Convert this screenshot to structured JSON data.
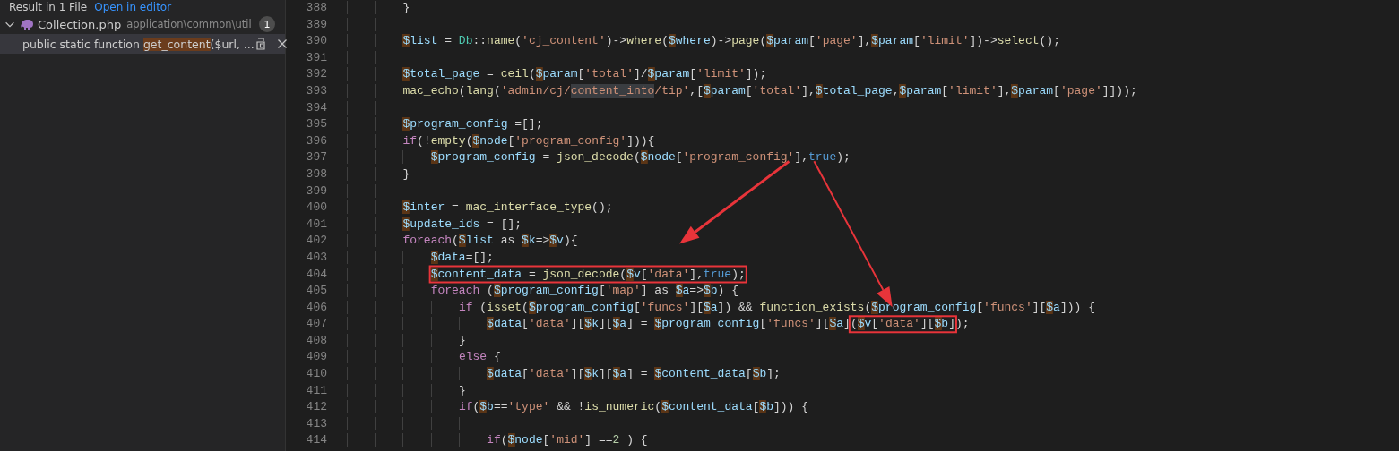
{
  "search_header": {
    "title": "Result in 1 File",
    "link": "Open in editor"
  },
  "results": [
    {
      "file": "Collection.php",
      "path": "application\\common\\util",
      "count": "1",
      "expanded": true,
      "matches": [
        {
          "before": "public static function ",
          "match": "get_content",
          "after": "($url, ...",
          "selected": true
        }
      ]
    }
  ],
  "editor": {
    "lines": [
      {
        "number": "388",
        "tokens": [
          {
            "kind": "plain",
            "text": "        }"
          }
        ]
      },
      {
        "number": "389"
      },
      {
        "number": "390",
        "tokens": [
          {
            "kind": "var",
            "text": "        $list"
          },
          {
            "kind": "plain",
            "text": " = "
          },
          {
            "kind": "cls",
            "text": "Db"
          },
          {
            "kind": "plain",
            "text": "::"
          },
          {
            "kind": "func",
            "text": "name"
          },
          {
            "kind": "plain",
            "text": "("
          },
          {
            "kind": "str",
            "text": "'cj_content'"
          },
          {
            "kind": "plain",
            "text": ")->"
          },
          {
            "kind": "func",
            "text": "where"
          },
          {
            "kind": "plain",
            "text": "("
          },
          {
            "kind": "var",
            "text": "$where"
          },
          {
            "kind": "plain",
            "text": ")->"
          },
          {
            "kind": "func",
            "text": "page"
          },
          {
            "kind": "plain",
            "text": "("
          },
          {
            "kind": "var",
            "text": "$param"
          },
          {
            "kind": "plain",
            "text": "["
          },
          {
            "kind": "str",
            "text": "'page'"
          },
          {
            "kind": "plain",
            "text": "],"
          },
          {
            "kind": "var",
            "text": "$param"
          },
          {
            "kind": "plain",
            "text": "["
          },
          {
            "kind": "str",
            "text": "'limit'"
          },
          {
            "kind": "plain",
            "text": "])->"
          },
          {
            "kind": "func",
            "text": "select"
          },
          {
            "kind": "plain",
            "text": "();"
          }
        ]
      },
      {
        "number": "391"
      },
      {
        "number": "392",
        "tokens": [
          {
            "kind": "var",
            "text": "        $total_page"
          },
          {
            "kind": "plain",
            "text": " = "
          },
          {
            "kind": "func",
            "text": "ceil"
          },
          {
            "kind": "plain",
            "text": "("
          },
          {
            "kind": "var",
            "text": "$param"
          },
          {
            "kind": "plain",
            "text": "["
          },
          {
            "kind": "str",
            "text": "'total'"
          },
          {
            "kind": "plain",
            "text": "]/"
          },
          {
            "kind": "var",
            "text": "$param"
          },
          {
            "kind": "plain",
            "text": "["
          },
          {
            "kind": "str",
            "text": "'limit'"
          },
          {
            "kind": "plain",
            "text": "]);"
          }
        ]
      },
      {
        "number": "393",
        "tokens": [
          {
            "kind": "func",
            "text": "        mac_echo"
          },
          {
            "kind": "plain",
            "text": "("
          },
          {
            "kind": "func",
            "text": "lang"
          },
          {
            "kind": "plain",
            "text": "("
          },
          {
            "kind": "str",
            "text": "'admin/cj/"
          },
          {
            "kind": "str",
            "text": "content_into",
            "highlight": true
          },
          {
            "kind": "str",
            "text": "/tip'"
          },
          {
            "kind": "plain",
            "text": ",["
          },
          {
            "kind": "var",
            "text": "$param"
          },
          {
            "kind": "plain",
            "text": "["
          },
          {
            "kind": "str",
            "text": "'total'"
          },
          {
            "kind": "plain",
            "text": "],"
          },
          {
            "kind": "var",
            "text": "$total_page"
          },
          {
            "kind": "plain",
            "text": ","
          },
          {
            "kind": "var",
            "text": "$param"
          },
          {
            "kind": "plain",
            "text": "["
          },
          {
            "kind": "str",
            "text": "'limit'"
          },
          {
            "kind": "plain",
            "text": "],"
          },
          {
            "kind": "var",
            "text": "$param"
          },
          {
            "kind": "plain",
            "text": "["
          },
          {
            "kind": "str",
            "text": "'page'"
          },
          {
            "kind": "plain",
            "text": "]]));"
          }
        ]
      },
      {
        "number": "394"
      },
      {
        "number": "395",
        "tokens": [
          {
            "kind": "var",
            "text": "        $program_config"
          },
          {
            "kind": "plain",
            "text": " =[];"
          }
        ]
      },
      {
        "number": "396",
        "tokens": [
          {
            "kind": "kw",
            "text": "        if"
          },
          {
            "kind": "plain",
            "text": "(!"
          },
          {
            "kind": "func",
            "text": "empty"
          },
          {
            "kind": "plain",
            "text": "("
          },
          {
            "kind": "var",
            "text": "$node"
          },
          {
            "kind": "plain",
            "text": "["
          },
          {
            "kind": "str",
            "text": "'program_config'"
          },
          {
            "kind": "plain",
            "text": "])){"
          }
        ]
      },
      {
        "number": "397",
        "tokens": [
          {
            "kind": "var",
            "text": "            $program_config"
          },
          {
            "kind": "plain",
            "text": " = "
          },
          {
            "kind": "func",
            "text": "json_decode"
          },
          {
            "kind": "plain",
            "text": "("
          },
          {
            "kind": "var",
            "text": "$node"
          },
          {
            "kind": "plain",
            "text": "["
          },
          {
            "kind": "str",
            "text": "'program_config'",
            "arrow_origin": true
          },
          {
            "kind": "plain",
            "text": "],"
          },
          {
            "kind": "const",
            "text": "true"
          },
          {
            "kind": "plain",
            "text": ");"
          }
        ]
      },
      {
        "number": "398",
        "tokens": [
          {
            "kind": "plain",
            "text": "        }"
          }
        ]
      },
      {
        "number": "399"
      },
      {
        "number": "400",
        "tokens": [
          {
            "kind": "var",
            "text": "        $inter"
          },
          {
            "kind": "plain",
            "text": " = "
          },
          {
            "kind": "func",
            "text": "mac_interface_type"
          },
          {
            "kind": "plain",
            "text": "();"
          }
        ]
      },
      {
        "number": "401",
        "tokens": [
          {
            "kind": "var",
            "text": "        $update_ids"
          },
          {
            "kind": "plain",
            "text": " = [];"
          }
        ]
      },
      {
        "number": "402",
        "tokens": [
          {
            "kind": "kw",
            "text": "        foreach"
          },
          {
            "kind": "plain",
            "text": "("
          },
          {
            "kind": "var",
            "text": "$list"
          },
          {
            "kind": "plain",
            "text": " as "
          },
          {
            "kind": "var",
            "text": "$k"
          },
          {
            "kind": "plain",
            "text": "=>"
          },
          {
            "kind": "var",
            "text": "$v"
          },
          {
            "kind": "plain",
            "text": "){"
          }
        ]
      },
      {
        "number": "403",
        "tokens": [
          {
            "kind": "var",
            "text": "            $data"
          },
          {
            "kind": "plain",
            "text": "=[];"
          }
        ]
      },
      {
        "number": "404",
        "tokens": [
          {
            "kind": "group",
            "boxed": true,
            "tokens": [
              {
                "kind": "var",
                "text": "            $content_data"
              },
              {
                "kind": "plain",
                "text": " = "
              },
              {
                "kind": "func",
                "text": "json_decode"
              },
              {
                "kind": "plain",
                "text": "("
              },
              {
                "kind": "var",
                "text": "$v"
              },
              {
                "kind": "plain",
                "text": "["
              },
              {
                "kind": "str",
                "text": "'data'"
              },
              {
                "kind": "plain",
                "text": "],"
              },
              {
                "kind": "const",
                "text": "true"
              },
              {
                "kind": "plain",
                "text": ");"
              }
            ]
          }
        ]
      },
      {
        "number": "405",
        "tokens": [
          {
            "kind": "kw",
            "text": "            foreach"
          },
          {
            "kind": "plain",
            "text": " ("
          },
          {
            "kind": "var",
            "text": "$program_config"
          },
          {
            "kind": "plain",
            "text": "["
          },
          {
            "kind": "str",
            "text": "'map'"
          },
          {
            "kind": "plain",
            "text": "] as "
          },
          {
            "kind": "var",
            "text": "$a"
          },
          {
            "kind": "plain",
            "text": "=>"
          },
          {
            "kind": "var",
            "text": "$b"
          },
          {
            "kind": "plain",
            "text": ") {"
          }
        ]
      },
      {
        "number": "406",
        "tokens": [
          {
            "kind": "kw",
            "text": "                if"
          },
          {
            "kind": "plain",
            "text": " ("
          },
          {
            "kind": "func",
            "text": "isset"
          },
          {
            "kind": "plain",
            "text": "("
          },
          {
            "kind": "var",
            "text": "$program_config"
          },
          {
            "kind": "plain",
            "text": "["
          },
          {
            "kind": "str",
            "text": "'funcs'"
          },
          {
            "kind": "plain",
            "text": "]["
          },
          {
            "kind": "var",
            "text": "$a"
          },
          {
            "kind": "plain",
            "text": "]) && "
          },
          {
            "kind": "func",
            "text": "function_exists"
          },
          {
            "kind": "plain",
            "text": "("
          },
          {
            "kind": "var",
            "text": "$program_config"
          },
          {
            "kind": "plain",
            "text": "["
          },
          {
            "kind": "str",
            "text": "'funcs'"
          },
          {
            "kind": "plain",
            "text": "]["
          },
          {
            "kind": "var",
            "text": "$a"
          },
          {
            "kind": "plain",
            "text": "])) {"
          }
        ]
      },
      {
        "number": "407",
        "tokens": [
          {
            "kind": "var",
            "text": "                    $data"
          },
          {
            "kind": "plain",
            "text": "["
          },
          {
            "kind": "str",
            "text": "'data'"
          },
          {
            "kind": "plain",
            "text": "]["
          },
          {
            "kind": "var",
            "text": "$k"
          },
          {
            "kind": "plain",
            "text": "]["
          },
          {
            "kind": "var",
            "text": "$a"
          },
          {
            "kind": "plain",
            "text": "] = "
          },
          {
            "kind": "var",
            "text": "$program_config"
          },
          {
            "kind": "plain",
            "text": "["
          },
          {
            "kind": "str",
            "text": "'funcs'"
          },
          {
            "kind": "plain",
            "text": "]["
          },
          {
            "kind": "var",
            "text": "$a"
          },
          {
            "kind": "plain",
            "text": "]"
          },
          {
            "kind": "group",
            "boxed": true,
            "tokens": [
              {
                "kind": "plain",
                "text": "("
              },
              {
                "kind": "var",
                "text": "$v"
              },
              {
                "kind": "plain",
                "text": "["
              },
              {
                "kind": "str",
                "text": "'data'"
              },
              {
                "kind": "plain",
                "text": "]["
              },
              {
                "kind": "var",
                "text": "$b"
              },
              {
                "kind": "plain",
                "text": "]"
              }
            ]
          },
          {
            "kind": "plain",
            "text": ");"
          }
        ]
      },
      {
        "number": "408",
        "tokens": [
          {
            "kind": "plain",
            "text": "                }"
          }
        ]
      },
      {
        "number": "409",
        "tokens": [
          {
            "kind": "kw",
            "text": "                else"
          },
          {
            "kind": "plain",
            "text": " {"
          }
        ]
      },
      {
        "number": "410",
        "tokens": [
          {
            "kind": "var",
            "text": "                    $data"
          },
          {
            "kind": "plain",
            "text": "["
          },
          {
            "kind": "str",
            "text": "'data'"
          },
          {
            "kind": "plain",
            "text": "]["
          },
          {
            "kind": "var",
            "text": "$k"
          },
          {
            "kind": "plain",
            "text": "]["
          },
          {
            "kind": "var",
            "text": "$a"
          },
          {
            "kind": "plain",
            "text": "] = "
          },
          {
            "kind": "var",
            "text": "$content_data"
          },
          {
            "kind": "plain",
            "text": "["
          },
          {
            "kind": "var",
            "text": "$b"
          },
          {
            "kind": "plain",
            "text": "];"
          }
        ]
      },
      {
        "number": "411",
        "tokens": [
          {
            "kind": "plain",
            "text": "                }"
          }
        ]
      },
      {
        "number": "412",
        "tokens": [
          {
            "kind": "kw",
            "text": "                if"
          },
          {
            "kind": "plain",
            "text": "("
          },
          {
            "kind": "var",
            "text": "$b"
          },
          {
            "kind": "plain",
            "text": "=="
          },
          {
            "kind": "str",
            "text": "'type'"
          },
          {
            "kind": "plain",
            "text": " && !"
          },
          {
            "kind": "func",
            "text": "is_numeric"
          },
          {
            "kind": "plain",
            "text": "("
          },
          {
            "kind": "var",
            "text": "$content_data"
          },
          {
            "kind": "plain",
            "text": "["
          },
          {
            "kind": "var",
            "text": "$b"
          },
          {
            "kind": "plain",
            "text": "])) {"
          }
        ]
      },
      {
        "number": "413"
      },
      {
        "number": "414",
        "tokens": [
          {
            "kind": "kw",
            "text": "                    if"
          },
          {
            "kind": "plain",
            "text": "("
          },
          {
            "kind": "var",
            "text": "$node"
          },
          {
            "kind": "plain",
            "text": "["
          },
          {
            "kind": "str",
            "text": "'mid'"
          },
          {
            "kind": "plain",
            "text": "] =="
          },
          {
            "kind": "num",
            "text": "2"
          },
          {
            "kind": "plain",
            "text": " ) {"
          }
        ]
      }
    ],
    "annotations": [
      {
        "kind": "arrow"
      },
      {
        "kind": "arrow"
      }
    ]
  }
}
